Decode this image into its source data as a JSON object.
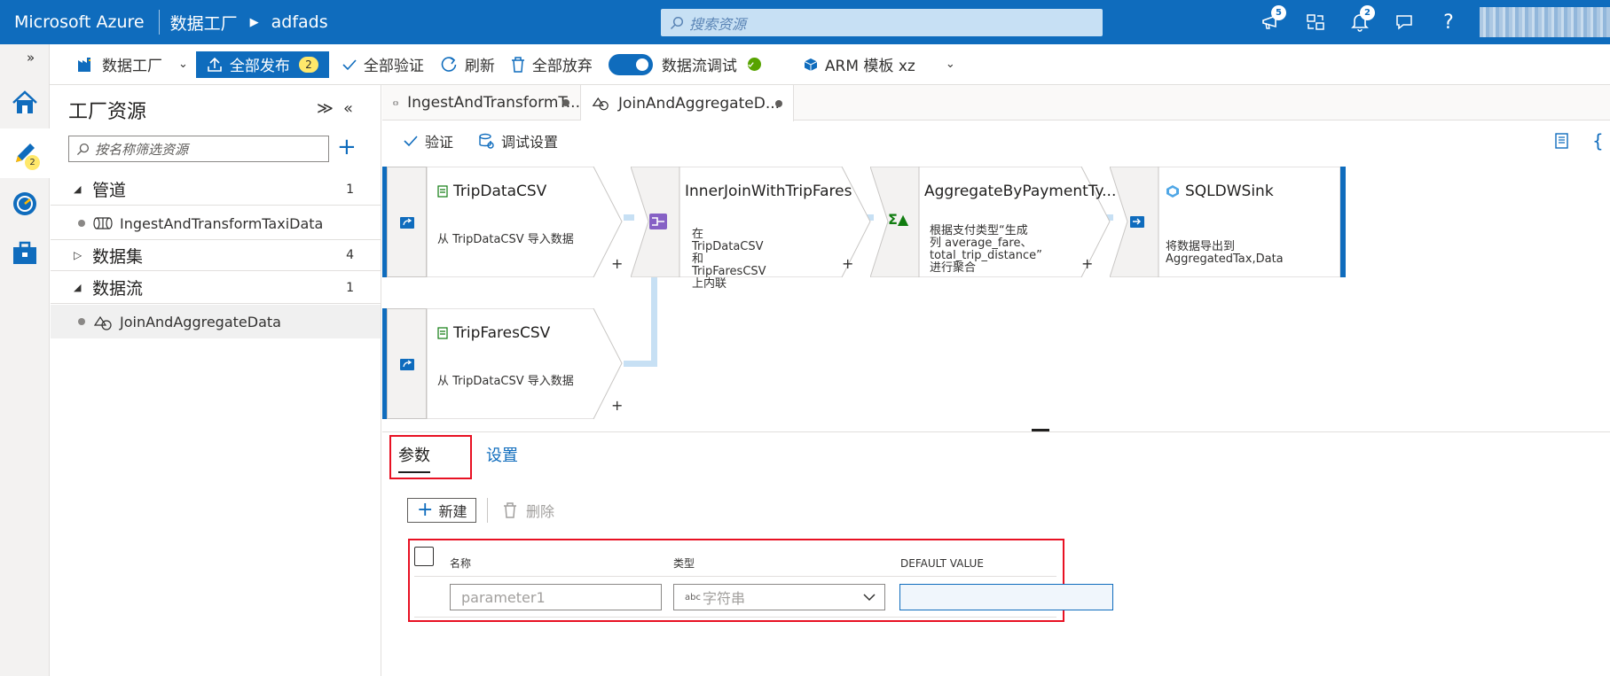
{
  "topbar": {
    "brand": "Microsoft Azure",
    "crumb1": "数据工厂",
    "crumb2": "adfads",
    "search_placeholder": "搜索资源",
    "badges": {
      "feedback": "5",
      "notifications": "2"
    },
    "accent": "#0f6cbd"
  },
  "rail": {
    "author_badge": "2"
  },
  "toolbar": {
    "factory_label": "数据工厂",
    "publish_label": "全部发布",
    "publish_count": "2",
    "validate_label": "全部验证",
    "refresh_label": "刷新",
    "discard_label": "全部放弃",
    "debug_label": "数据流调试",
    "arm_label": "ARM 模板 xz"
  },
  "resources": {
    "title": "工厂资源",
    "filter_placeholder": "按名称筛选资源",
    "categories": [
      {
        "label": "管道",
        "count": "1"
      },
      {
        "label": "数据集",
        "count": "4"
      },
      {
        "label": "数据流",
        "count": "1"
      }
    ],
    "pipeline_item": "IngestAndTransformTaxiData",
    "dataflow_item": "JoinAndAggregateData"
  },
  "tabs": [
    {
      "label": "IngestAndTransformT..."
    },
    {
      "label": "JoinAndAggregateD..."
    }
  ],
  "subbar": {
    "validate": "验证",
    "debug_settings": "调试设置"
  },
  "nodes": {
    "source1": {
      "title": "TripDataCSV",
      "desc": "从 TripDataCSV 导入数据"
    },
    "join": {
      "title": "InnerJoinWithTripFares",
      "desc1": "在 TripDataCSV 和",
      "desc2": "TripFaresCSV 上内联"
    },
    "aggregate": {
      "title": "AggregateByPaymentTy...",
      "desc1": "根据支付类型“生成",
      "desc2": "列 average_fare、",
      "desc3": "total_trip_distance”",
      "desc4": "进行聚合"
    },
    "sink": {
      "title": "SQLDWSink",
      "desc1": "将数据导出到",
      "desc2": "AggregatedTax,Data"
    },
    "source2": {
      "title": "TripFaresCSV",
      "desc": "从 TripDataCSV 导入数据"
    },
    "plus": "+"
  },
  "bottom": {
    "tab_params": "参数",
    "tab_settings": "设置",
    "new_label": "新建",
    "delete_label": "删除",
    "columns": [
      "名称",
      "类型",
      "DEFAULT VALUE"
    ],
    "row": {
      "name_placeholder": "parameter1",
      "type_value": "字符串",
      "type_prefix": "abc"
    }
  }
}
